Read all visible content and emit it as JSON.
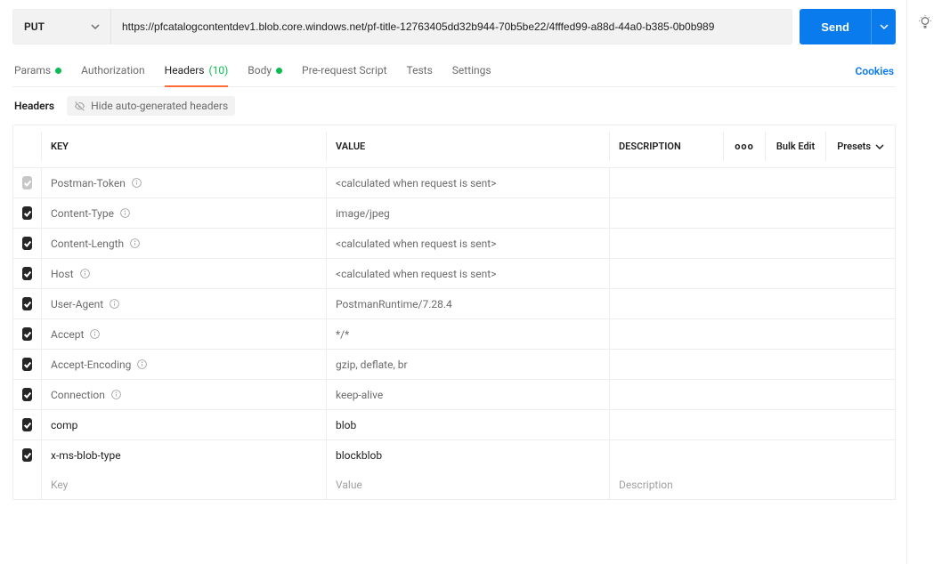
{
  "request": {
    "method": "PUT",
    "url": "https://pfcatalogcontentdev1.blob.core.windows.net/pf-title-12763405dd32b944-70b5be22/4fffed99-a88d-44a0-b385-0b0b989",
    "send_label": "Send"
  },
  "tabs": {
    "params": "Params",
    "authorization": "Authorization",
    "headers": "Headers",
    "headers_count": "(10)",
    "body": "Body",
    "prerequest": "Pre-request Script",
    "tests": "Tests",
    "settings": "Settings",
    "cookies": "Cookies"
  },
  "subbar": {
    "label": "Headers",
    "hide": "Hide auto-generated headers"
  },
  "columns": {
    "key": "KEY",
    "value": "VALUE",
    "description": "DESCRIPTION",
    "bulk": "Bulk Edit",
    "presets": "Presets",
    "more": "ooo"
  },
  "placeholders": {
    "key": "Key",
    "value": "Value",
    "description": "Description"
  },
  "headers": [
    {
      "key": "Postman-Token",
      "value": "<calculated when request is sent>",
      "auto": true,
      "dim": true,
      "info": true
    },
    {
      "key": "Content-Type",
      "value": "image/jpeg",
      "auto": true,
      "dim": false,
      "info": true
    },
    {
      "key": "Content-Length",
      "value": "<calculated when request is sent>",
      "auto": true,
      "dim": false,
      "info": true
    },
    {
      "key": "Host",
      "value": "<calculated when request is sent>",
      "auto": true,
      "dim": false,
      "info": true
    },
    {
      "key": "User-Agent",
      "value": "PostmanRuntime/7.28.4",
      "auto": true,
      "dim": false,
      "info": true
    },
    {
      "key": "Accept",
      "value": "*/*",
      "auto": true,
      "dim": false,
      "info": true
    },
    {
      "key": "Accept-Encoding",
      "value": "gzip, deflate, br",
      "auto": true,
      "dim": false,
      "info": true
    },
    {
      "key": "Connection",
      "value": "keep-alive",
      "auto": true,
      "dim": false,
      "info": true
    },
    {
      "key": "comp",
      "value": "blob",
      "auto": false,
      "dim": false,
      "info": false
    },
    {
      "key": "x-ms-blob-type",
      "value": "blockblob",
      "auto": false,
      "dim": false,
      "info": false
    }
  ]
}
